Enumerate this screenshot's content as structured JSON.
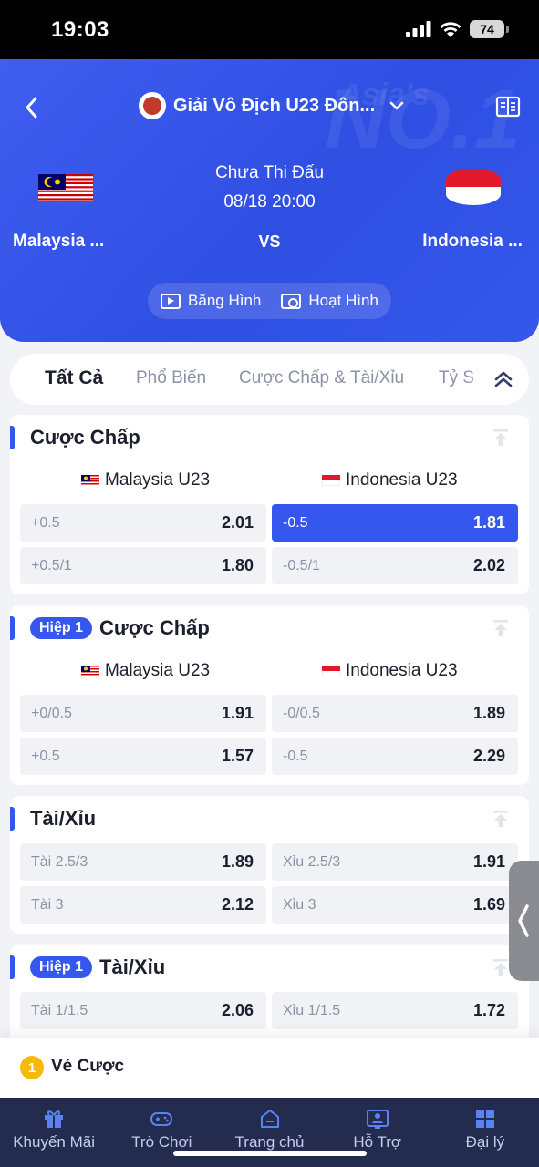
{
  "status_bar": {
    "time": "19:03",
    "battery": "74"
  },
  "header": {
    "league": "Giải Vô Địch U23 Đôn...",
    "watermark_top": "Asia's",
    "watermark_main": "NO.1",
    "match_status": "Chưa Thi Đấu",
    "match_datetime": "08/18  20:00",
    "vs": "VS",
    "home_team": "Malaysia ...",
    "away_team": "Indonesia ...",
    "video_label": "Băng Hình",
    "animation_label": "Hoạt Hình"
  },
  "tabs": [
    "Tất Cả",
    "Phổ Biến",
    "Cược Chấp & Tài/Xỉu",
    "Tỷ S"
  ],
  "markets": [
    {
      "title": "Cược Chấp",
      "badge": "",
      "home": "Malaysia U23",
      "away": "Indonesia U23",
      "rows": [
        [
          {
            "label": "+0.5",
            "odds": "2.01",
            "selected": false
          },
          {
            "label": "-0.5",
            "odds": "1.81",
            "selected": true
          }
        ],
        [
          {
            "label": "+0.5/1",
            "odds": "1.80",
            "selected": false
          },
          {
            "label": "-0.5/1",
            "odds": "2.02",
            "selected": false
          }
        ]
      ]
    },
    {
      "title": "Cược Chấp",
      "badge": "Hiệp 1",
      "home": "Malaysia U23",
      "away": "Indonesia U23",
      "rows": [
        [
          {
            "label": "+0/0.5",
            "odds": "1.91",
            "selected": false
          },
          {
            "label": "-0/0.5",
            "odds": "1.89",
            "selected": false
          }
        ],
        [
          {
            "label": "+0.5",
            "odds": "1.57",
            "selected": false
          },
          {
            "label": "-0.5",
            "odds": "2.29",
            "selected": false
          }
        ]
      ]
    },
    {
      "title": "Tài/Xỉu",
      "badge": "",
      "rows": [
        [
          {
            "label": "Tài 2.5/3",
            "odds": "1.89",
            "selected": false
          },
          {
            "label": "Xỉu 2.5/3",
            "odds": "1.91",
            "selected": false
          }
        ],
        [
          {
            "label": "Tài 3",
            "odds": "2.12",
            "selected": false
          },
          {
            "label": "Xỉu 3",
            "odds": "1.69",
            "selected": false
          }
        ]
      ]
    },
    {
      "title": "Tài/Xỉu",
      "badge": "Hiệp 1",
      "rows": [
        [
          {
            "label": "Tài 1/1.5",
            "odds": "2.06",
            "selected": false
          },
          {
            "label": "Xỉu 1/1.5",
            "odds": "1.72",
            "selected": false
          }
        ]
      ]
    }
  ],
  "bet_slip": {
    "count": "1",
    "label": "Vé Cược"
  },
  "bottom_nav": [
    {
      "label": "Khuyến Mãi",
      "icon": "gift-icon"
    },
    {
      "label": "Trò Chơi",
      "icon": "gamepad-icon"
    },
    {
      "label": "Trang chủ",
      "icon": "home-icon"
    },
    {
      "label": "Hỗ Trợ",
      "icon": "support-icon"
    },
    {
      "label": "Đại lý",
      "icon": "agent-icon"
    }
  ],
  "colors": {
    "primary": "#3657ef",
    "nav_bg": "#232c4f",
    "badge_yellow": "#f6b90c"
  }
}
